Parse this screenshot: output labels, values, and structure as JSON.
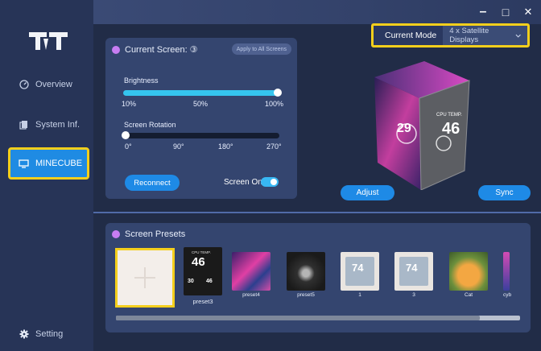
{
  "sidebar": {
    "items": [
      {
        "label": "Overview"
      },
      {
        "label": "System Inf."
      },
      {
        "label": "MINECUBE"
      },
      {
        "label": "Setting"
      }
    ]
  },
  "window": {
    "minimize": "–",
    "maximize": "□",
    "close": "✕"
  },
  "mode": {
    "label": "Current Mode",
    "value": "4 x Satellite Displays"
  },
  "current_screen": {
    "title": "Current Screen:",
    "number": "③",
    "apply_label": "Apply to All Screens",
    "brightness_label": "Brightness",
    "brightness_value": 1.0,
    "brightness_ticks": [
      "10%",
      "50%",
      "100%"
    ],
    "rotation_label": "Screen Rotation",
    "rotation_value": 0,
    "rotation_ticks": [
      "0°",
      "90°",
      "180°",
      "270°"
    ],
    "reconnect_label": "Reconnect",
    "screen_on_label": "Screen On"
  },
  "cube": {
    "cpu_label": "CPU TEMP.",
    "cpu_value": "46",
    "left_face_value": "29",
    "adjust_label": "Adjust",
    "sync_label": "Sync"
  },
  "presets": {
    "title": "Screen Presets",
    "items": [
      {
        "label": "preset3"
      },
      {
        "label": "preset4"
      },
      {
        "label": "preset5"
      },
      {
        "label": "1"
      },
      {
        "label": "3"
      },
      {
        "label": "Cat"
      },
      {
        "label": "cyb"
      }
    ],
    "preset3_main": "46",
    "preset3_cpu": "CPU TEMP.",
    "preset3_sub1": "30",
    "preset3_sub2": "46",
    "gauge_value": "74"
  }
}
